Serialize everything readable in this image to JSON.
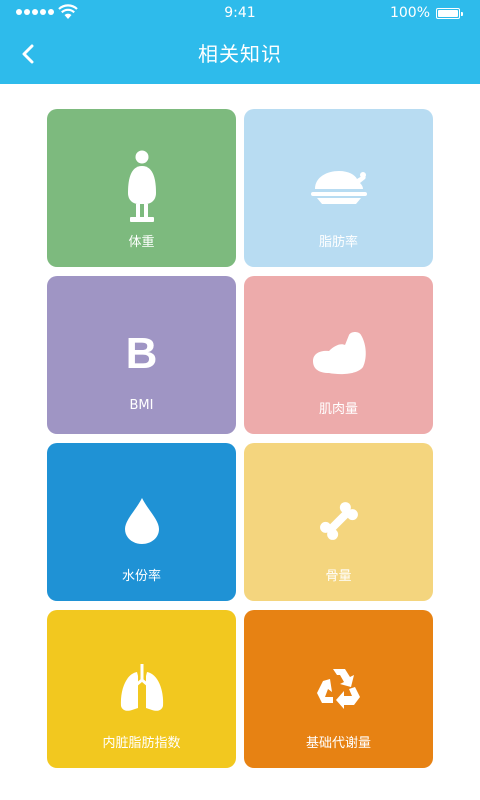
{
  "status_bar": {
    "time": "9:41",
    "battery_percent": "100%"
  },
  "header": {
    "title": "相关知识",
    "background_color": "#2ebbeb",
    "back_icon": "chevron-left-icon"
  },
  "tiles": [
    {
      "label": "体重",
      "icon": "person-scale-icon",
      "color": "#7dba7e"
    },
    {
      "label": "脂肪率",
      "icon": "roast-chicken-icon",
      "color": "#b8dcf2"
    },
    {
      "label": "BMI",
      "icon": "letter-b-icon",
      "icon_text": "B",
      "color": "#9f95c4"
    },
    {
      "label": "肌肉量",
      "icon": "flexed-arm-icon",
      "color": "#edabab"
    },
    {
      "label": "水份率",
      "icon": "water-drop-icon",
      "color": "#1f92d5"
    },
    {
      "label": "骨量",
      "icon": "bone-icon",
      "color": "#f4d57e"
    },
    {
      "label": "内脏脂肪指数",
      "icon": "lungs-icon",
      "color": "#f2c81f"
    },
    {
      "label": "基础代谢量",
      "icon": "recycle-icon",
      "color": "#e78213"
    }
  ]
}
